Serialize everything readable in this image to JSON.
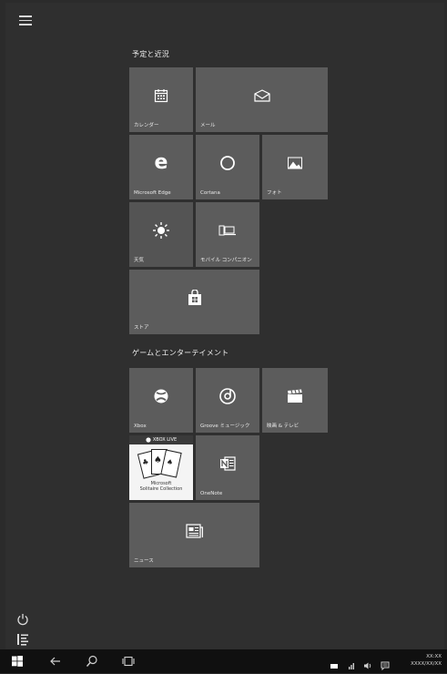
{
  "start": {
    "groups": [
      {
        "title": "予定と近況"
      },
      {
        "title": "ゲームとエンターテイメント"
      }
    ],
    "tiles": {
      "calendar": "カレンダー",
      "mail": "メール",
      "edge": "Microsoft Edge",
      "cortana": "Cortana",
      "photos": "フォト",
      "weather": "天気",
      "phone_companion": "モバイル コンパニオン",
      "store": "ストア",
      "xbox": "Xbox",
      "groove": "Groove ミュージック",
      "movies": "映画 & テレビ",
      "solitaire_badge": "XBOX LIVE",
      "solitaire_line1": "Microsoft",
      "solitaire_line2": "Solitaire Collection",
      "onenote": "OneNote",
      "news": "ニュース"
    }
  },
  "taskbar": {
    "clock_time": "XX:XX",
    "clock_date": "XXXX/XX/XX"
  },
  "colors": {
    "background": "#2f2f2f",
    "tile": "#5c5c5c",
    "taskbar": "#101010"
  }
}
